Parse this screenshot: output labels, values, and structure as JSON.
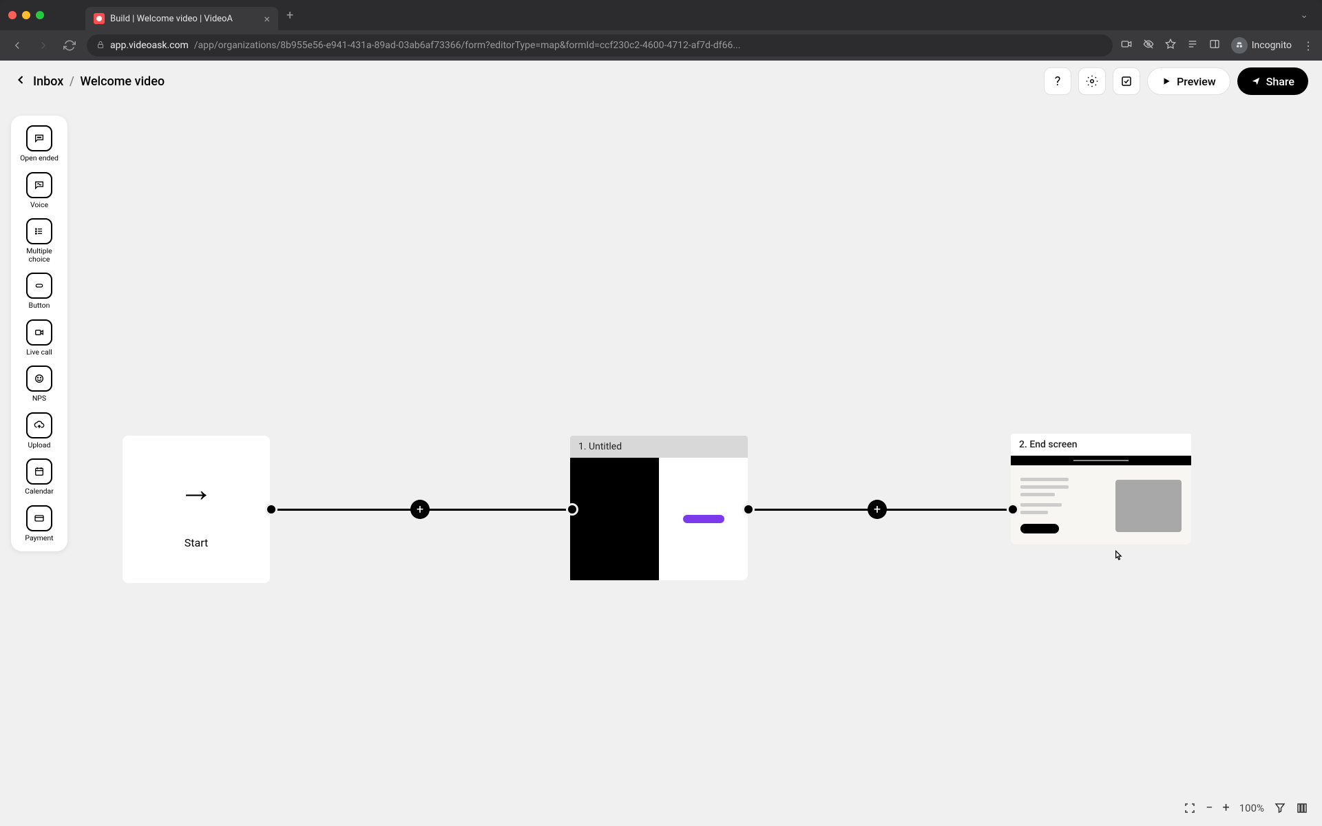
{
  "browser": {
    "tab_title": "Build | Welcome video | VideoA",
    "url_domain": "app.videoask.com",
    "url_path": "/app/organizations/8b955e56-e941-431a-89ad-03ab6af73366/form?editorType=map&formId=ccf230c2-4600-4712-af7d-df66...",
    "incognito_label": "Incognito"
  },
  "header": {
    "back_label": "Inbox",
    "page_title": "Welcome video",
    "preview_label": "Preview",
    "share_label": "Share"
  },
  "palette": {
    "items": [
      {
        "label": "Open ended",
        "icon": "chat"
      },
      {
        "label": "Voice",
        "icon": "voice"
      },
      {
        "label": "Multiple choice",
        "icon": "list"
      },
      {
        "label": "Button",
        "icon": "button"
      },
      {
        "label": "Live call",
        "icon": "video"
      },
      {
        "label": "NPS",
        "icon": "smile"
      },
      {
        "label": "Upload",
        "icon": "upload"
      },
      {
        "label": "Calendar",
        "icon": "calendar"
      },
      {
        "label": "Payment",
        "icon": "card"
      }
    ]
  },
  "canvas": {
    "start_label": "Start",
    "step1_label": "1. Untitled",
    "step2_label": "2. End screen",
    "accent_color": "#7c3aed"
  },
  "zoom": {
    "level": "100%"
  }
}
